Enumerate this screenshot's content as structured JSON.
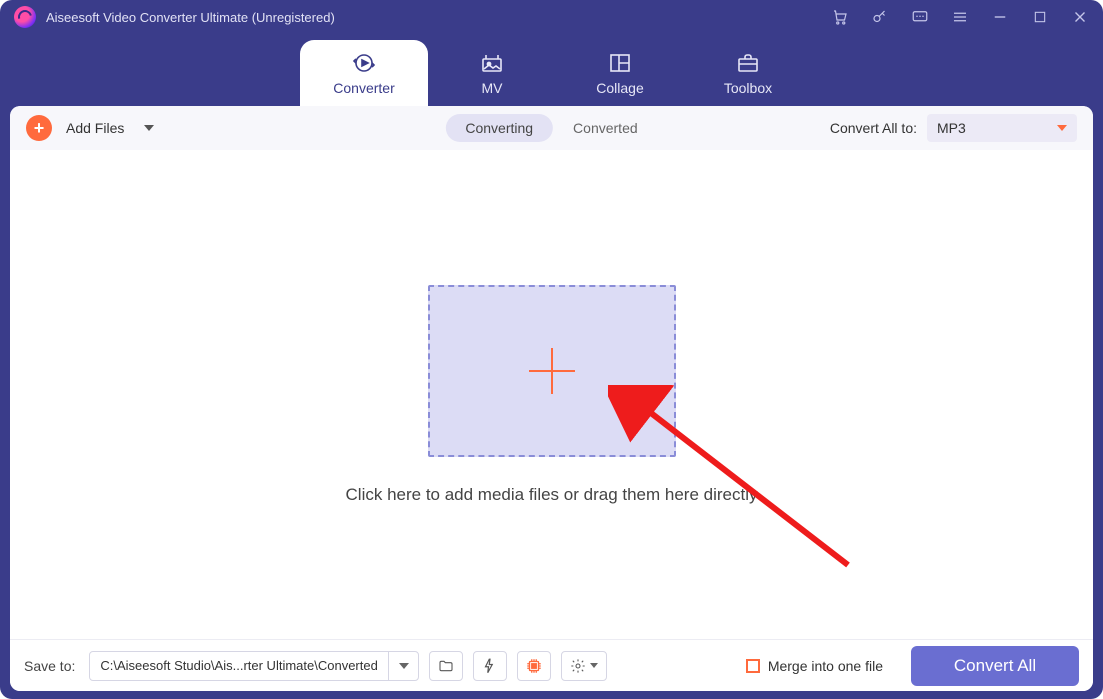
{
  "window": {
    "title": "Aiseesoft Video Converter Ultimate (Unregistered)"
  },
  "tabs": {
    "converter": "Converter",
    "mv": "MV",
    "collage": "Collage",
    "toolbox": "Toolbox"
  },
  "actionbar": {
    "add_files": "Add Files",
    "converting": "Converting",
    "converted": "Converted",
    "convert_all_to": "Convert All to:",
    "format_value": "MP3"
  },
  "dropzone": {
    "hint": "Click here to add media files or drag them here directly"
  },
  "bottombar": {
    "save_to": "Save to:",
    "path": "C:\\Aiseesoft Studio\\Ais...rter Ultimate\\Converted",
    "merge": "Merge into one file",
    "convert_all": "Convert All"
  }
}
